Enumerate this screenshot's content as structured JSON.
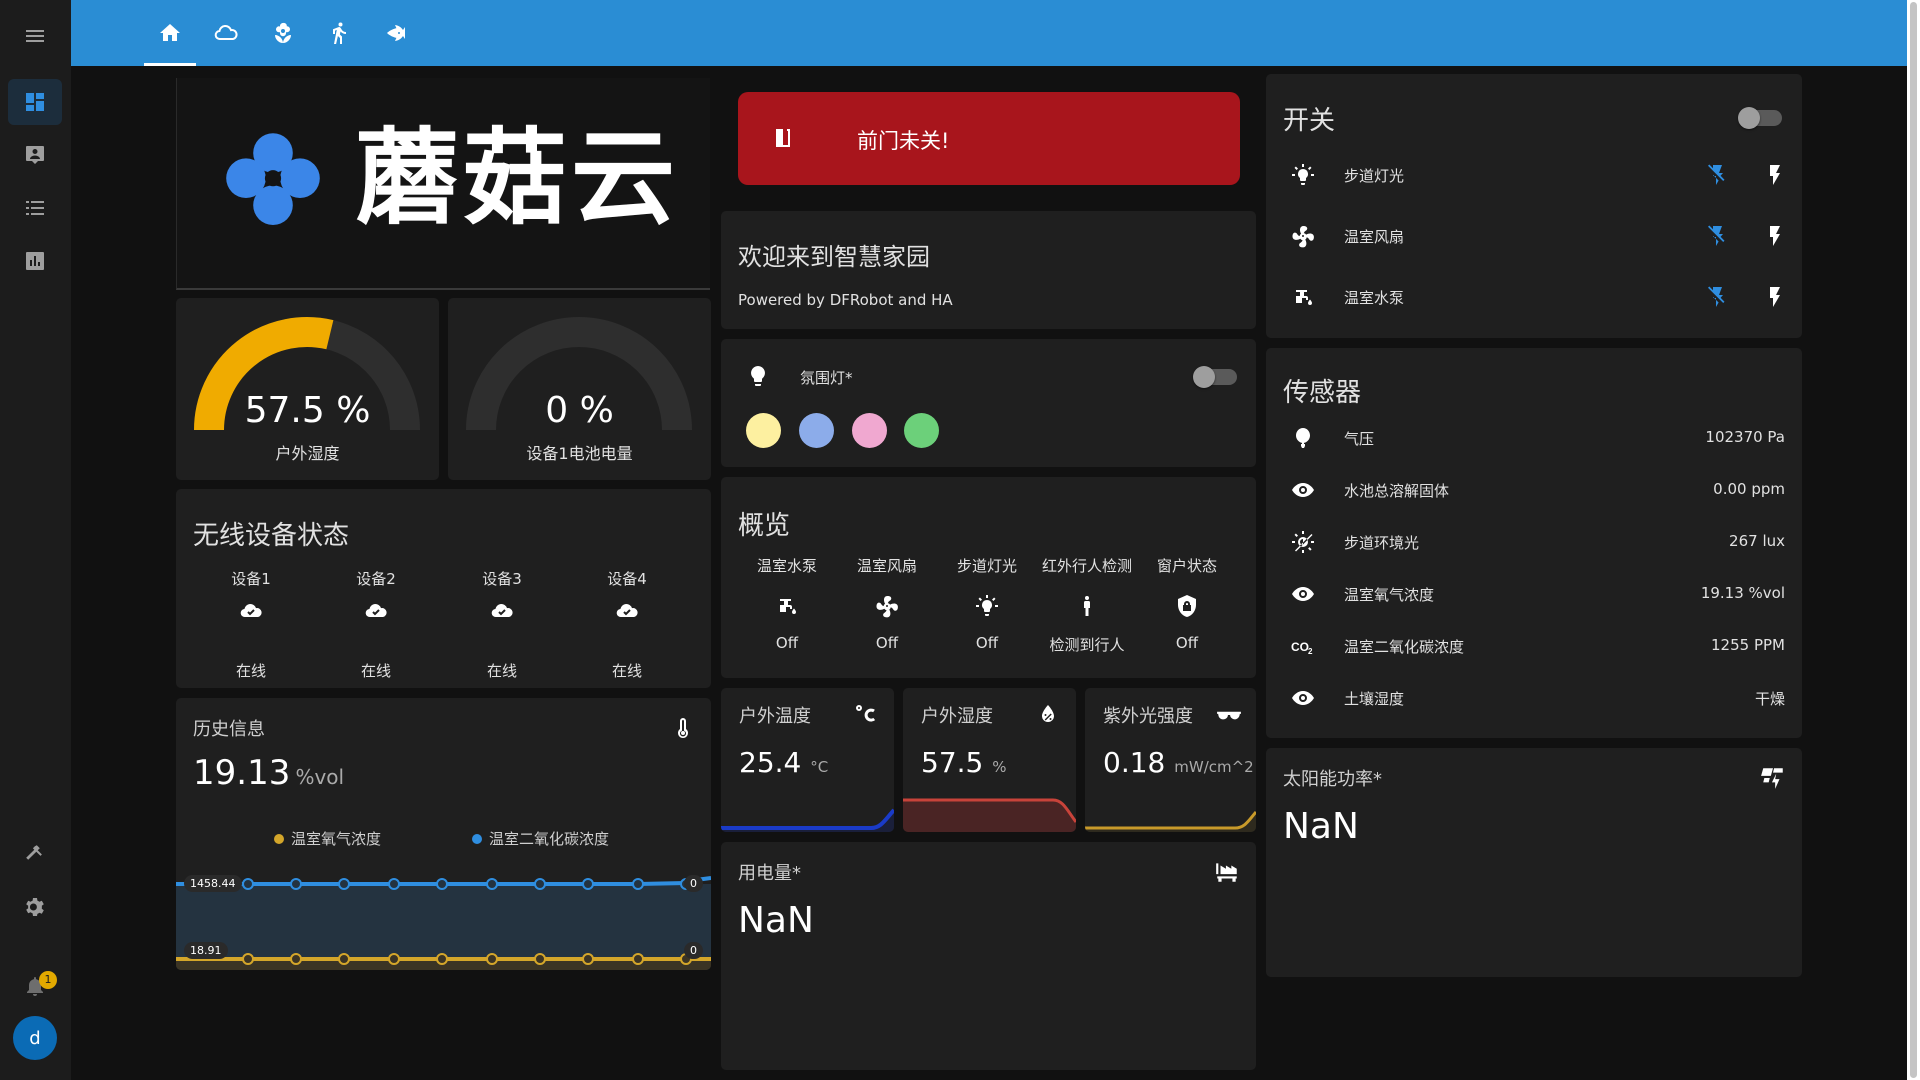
{
  "header": {
    "tabs": [
      {
        "icon": "home-icon"
      },
      {
        "icon": "cloud-icon"
      },
      {
        "icon": "flower-icon"
      },
      {
        "icon": "walk-icon"
      },
      {
        "icon": "fish-icon"
      }
    ]
  },
  "sidebar": {
    "items": [
      {
        "icon": "menu-icon"
      },
      {
        "icon": "dashboard-icon"
      },
      {
        "icon": "account-box-icon"
      },
      {
        "icon": "list-icon"
      },
      {
        "icon": "chart-box-icon"
      },
      {
        "icon": "hammer-icon"
      },
      {
        "icon": "gear-icon"
      },
      {
        "icon": "bell-icon"
      }
    ],
    "notification_count": "1",
    "avatar_letter": "d"
  },
  "logo": {
    "text": "蘑菇云"
  },
  "gauges": [
    {
      "value": "57.5 %",
      "label": "户外湿度",
      "fraction": 0.575,
      "color": "#f0ab00"
    },
    {
      "value": "0 %",
      "label": "设备1电池电量",
      "fraction": 0.0,
      "color": "#f0ab00"
    }
  ],
  "wireless": {
    "title": "无线设备状态",
    "devices": [
      {
        "name": "设备1",
        "status": "在线"
      },
      {
        "name": "设备2",
        "status": "在线"
      },
      {
        "name": "设备3",
        "status": "在线"
      },
      {
        "name": "设备4",
        "status": "在线"
      }
    ]
  },
  "history": {
    "title": "历史信息",
    "value": "19.13",
    "unit": "%vol",
    "legend": [
      {
        "name": "温室氧气浓度",
        "color": "#d4a62a"
      },
      {
        "name": "温室二氧化碳浓度",
        "color": "#2f8ee0"
      }
    ],
    "top_label": "1458.44",
    "bottom_label": "18.91",
    "end_label_top": "0",
    "end_label_bottom": "0"
  },
  "alert": {
    "text": "前门未关!"
  },
  "welcome": {
    "title": "欢迎来到智慧家园",
    "subtitle": "Powered by DFRobot and HA"
  },
  "ambient": {
    "label": "氛围灯*",
    "colors": [
      "#fdf0a0",
      "#8cacea",
      "#f0a8d0",
      "#6cd07a"
    ]
  },
  "overview": {
    "title": "概览",
    "items": [
      {
        "name": "温室水泵",
        "state": "Off",
        "icon": "water-pump-icon"
      },
      {
        "name": "温室风扇",
        "state": "Off",
        "icon": "fan-icon"
      },
      {
        "name": "步道灯光",
        "state": "Off",
        "icon": "lightbulb-icon"
      },
      {
        "name": "红外行人检测",
        "state": "检测到行人",
        "icon": "person-icon"
      },
      {
        "name": "窗户状态",
        "state": "Off",
        "icon": "shield-lock-icon"
      }
    ]
  },
  "sensor_cards": [
    {
      "title": "户外温度",
      "value": "25.4",
      "unit": "°C",
      "icon": "thermometer-celsius-icon",
      "color": "#1a3bc8"
    },
    {
      "title": "户外湿度",
      "value": "57.5",
      "unit": "%",
      "icon": "water-percent-icon",
      "color": "#c8433a"
    },
    {
      "title": "紫外光强度",
      "value": "0.18",
      "unit": "mW/cm^2",
      "icon": "sunglasses-icon",
      "color": "#c89a2a"
    }
  ],
  "power": {
    "title": "用电量*",
    "value": "NaN",
    "icon": "factory-icon"
  },
  "switches": {
    "title": "开关",
    "items": [
      {
        "name": "步道灯光",
        "icon": "lightbulb-on-icon"
      },
      {
        "name": "温室风扇",
        "icon": "fan-icon"
      },
      {
        "name": "温室水泵",
        "icon": "water-pump-icon"
      }
    ]
  },
  "sensors": {
    "title": "传感器",
    "items": [
      {
        "name": "气压",
        "value": "102370 Pa",
        "icon": "balloon-icon"
      },
      {
        "name": "水池总溶解固体",
        "value": "0.00 ppm",
        "icon": "eye-icon"
      },
      {
        "name": "步道环境光",
        "value": "267 lux",
        "icon": "brightness-icon"
      },
      {
        "name": "温室氧气浓度",
        "value": "19.13 %vol",
        "icon": "eye-icon"
      },
      {
        "name": "温室二氧化碳浓度",
        "value": "1255 PPM",
        "icon": "co2-icon"
      },
      {
        "name": "土壤湿度",
        "value": "干燥",
        "icon": "eye-icon"
      }
    ]
  },
  "solar": {
    "title": "太阳能功率*",
    "value": "NaN",
    "icon": "solar-power-icon"
  }
}
